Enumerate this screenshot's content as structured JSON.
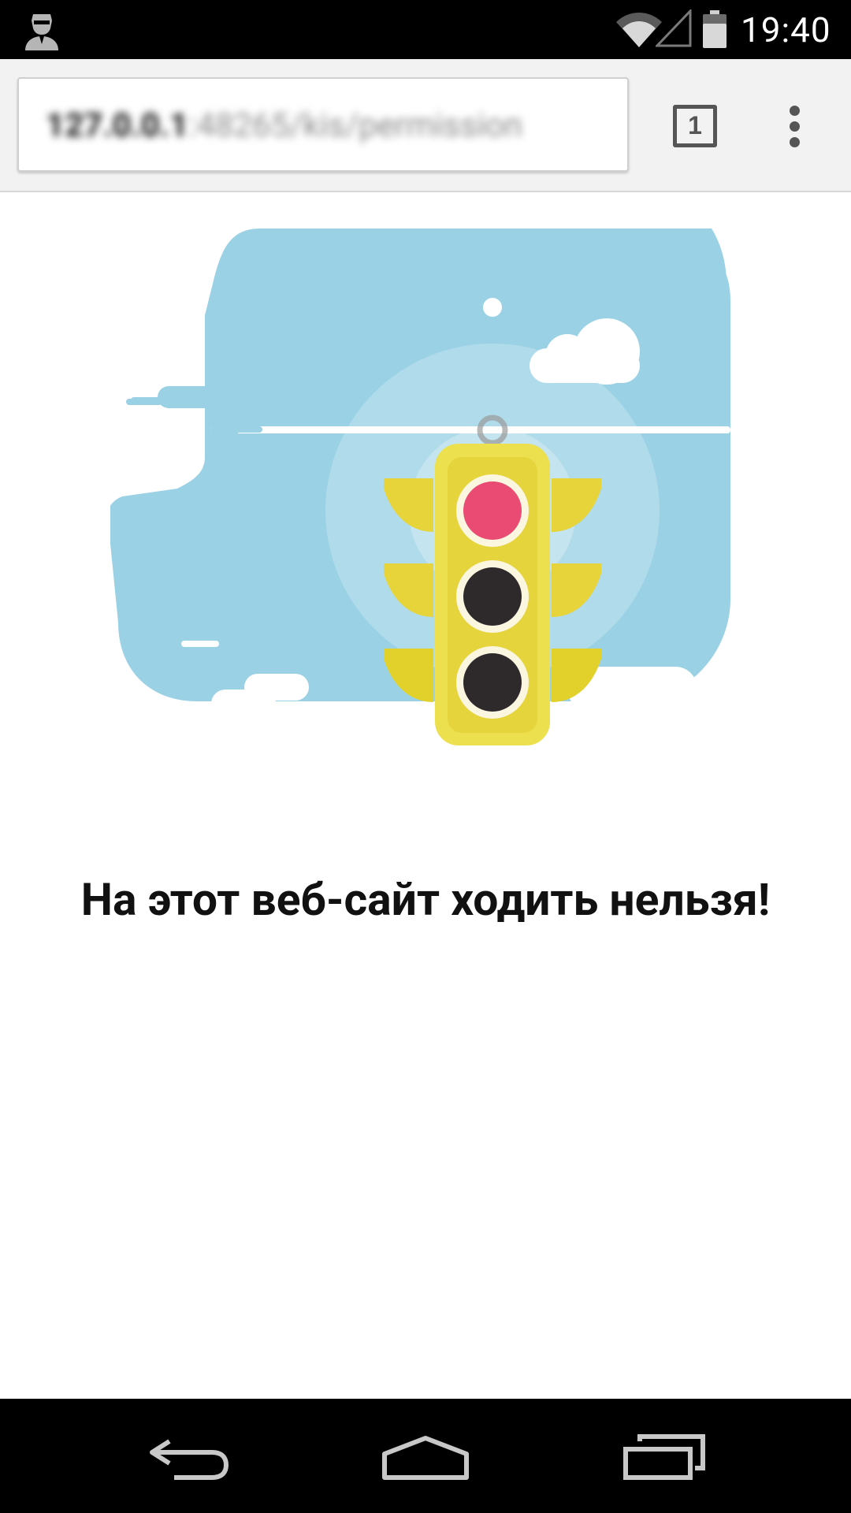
{
  "status_bar": {
    "time": "19:40",
    "icons": [
      "avatar-icon",
      "wifi-icon",
      "signal-icon",
      "battery-icon"
    ]
  },
  "toolbar": {
    "url_host": "127.0.0.1",
    "url_path": ":48265/kis/permission",
    "tab_count": "1",
    "menu_icon": "overflow-menu-icon"
  },
  "content": {
    "headline": "На этот веб-сайт ходить нельзя!",
    "illustration_icon": "traffic-light-icon"
  },
  "navigation": {
    "icons": [
      "back-icon",
      "home-icon",
      "recents-icon"
    ]
  },
  "colors": {
    "sky": "#9ad1e5",
    "traffic_light": "#e6d43a",
    "red_light": "#e94b72",
    "dark_light": "#2e2a2b"
  }
}
